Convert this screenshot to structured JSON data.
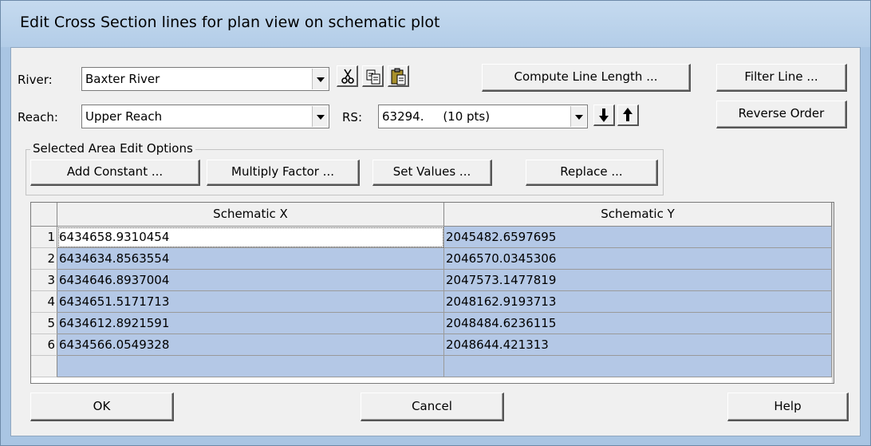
{
  "window": {
    "title": "Edit Cross Section lines for plan view on schematic plot"
  },
  "river": {
    "label": "River:",
    "value": "Baxter River"
  },
  "reach": {
    "label": "Reach:",
    "value": "Upper Reach"
  },
  "rs": {
    "label": "RS:",
    "value": "63294.     (10 pts)"
  },
  "toolbar": {
    "cut_icon": "scissors-icon",
    "copy_icon": "copy-icon",
    "paste_icon": "paste-icon",
    "down_icon": "arrow-down-icon",
    "up_icon": "arrow-up-icon"
  },
  "buttons": {
    "compute_line_length": "Compute Line Length ...",
    "filter_line": "Filter Line ...",
    "reverse_order": "Reverse Order",
    "ok": "OK",
    "cancel": "Cancel",
    "help": "Help"
  },
  "edit_options": {
    "group_label": "Selected Area Edit Options",
    "add_constant": "Add Constant ...",
    "multiply_factor": "Multiply Factor ...",
    "set_values": "Set Values ...",
    "replace": "Replace ..."
  },
  "table": {
    "columns": [
      "Schematic X",
      "Schematic Y"
    ],
    "rows": [
      {
        "n": "1",
        "x": "6434658.9310454",
        "y": "2045482.6597695"
      },
      {
        "n": "2",
        "x": "6434634.8563554",
        "y": "2046570.0345306"
      },
      {
        "n": "3",
        "x": "6434646.8937004",
        "y": "2047573.1477819"
      },
      {
        "n": "4",
        "x": "6434651.5171713",
        "y": "2048162.9193713"
      },
      {
        "n": "5",
        "x": "6434612.8921591",
        "y": "2048484.6236115"
      },
      {
        "n": "6",
        "x": "6434566.0549328",
        "y": "2048644.421313"
      }
    ]
  },
  "colors": {
    "selection": "#b4c8e6",
    "titlebar": "#b9d1ea"
  }
}
